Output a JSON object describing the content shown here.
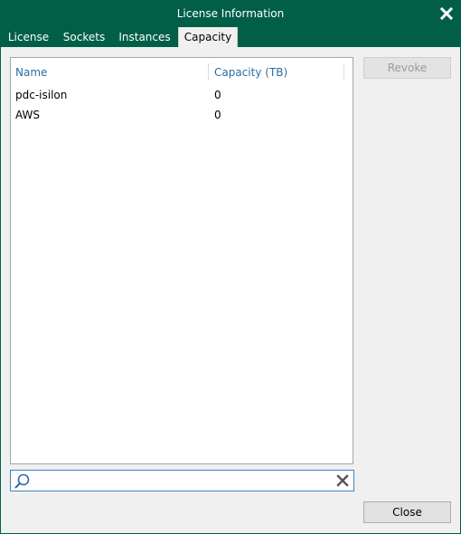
{
  "window": {
    "title": "License Information",
    "close_icon": "close-icon"
  },
  "tabs": [
    {
      "label": "License"
    },
    {
      "label": "Sockets"
    },
    {
      "label": "Instances"
    },
    {
      "label": "Capacity",
      "selected": true
    }
  ],
  "table": {
    "columns": [
      "Name",
      "Capacity (TB)"
    ],
    "rows": [
      {
        "name": "pdc-isilon",
        "capacity": "0"
      },
      {
        "name": "AWS",
        "capacity": "0"
      }
    ]
  },
  "buttons": {
    "revoke": "Revoke",
    "close": "Close"
  },
  "search": {
    "value": "",
    "placeholder": "",
    "search_icon": "search-icon",
    "clear_icon": "clear-icon"
  },
  "colors": {
    "titlebar": "#005f46",
    "header_text": "#2a6ea6",
    "search_border": "#3a84c4"
  }
}
